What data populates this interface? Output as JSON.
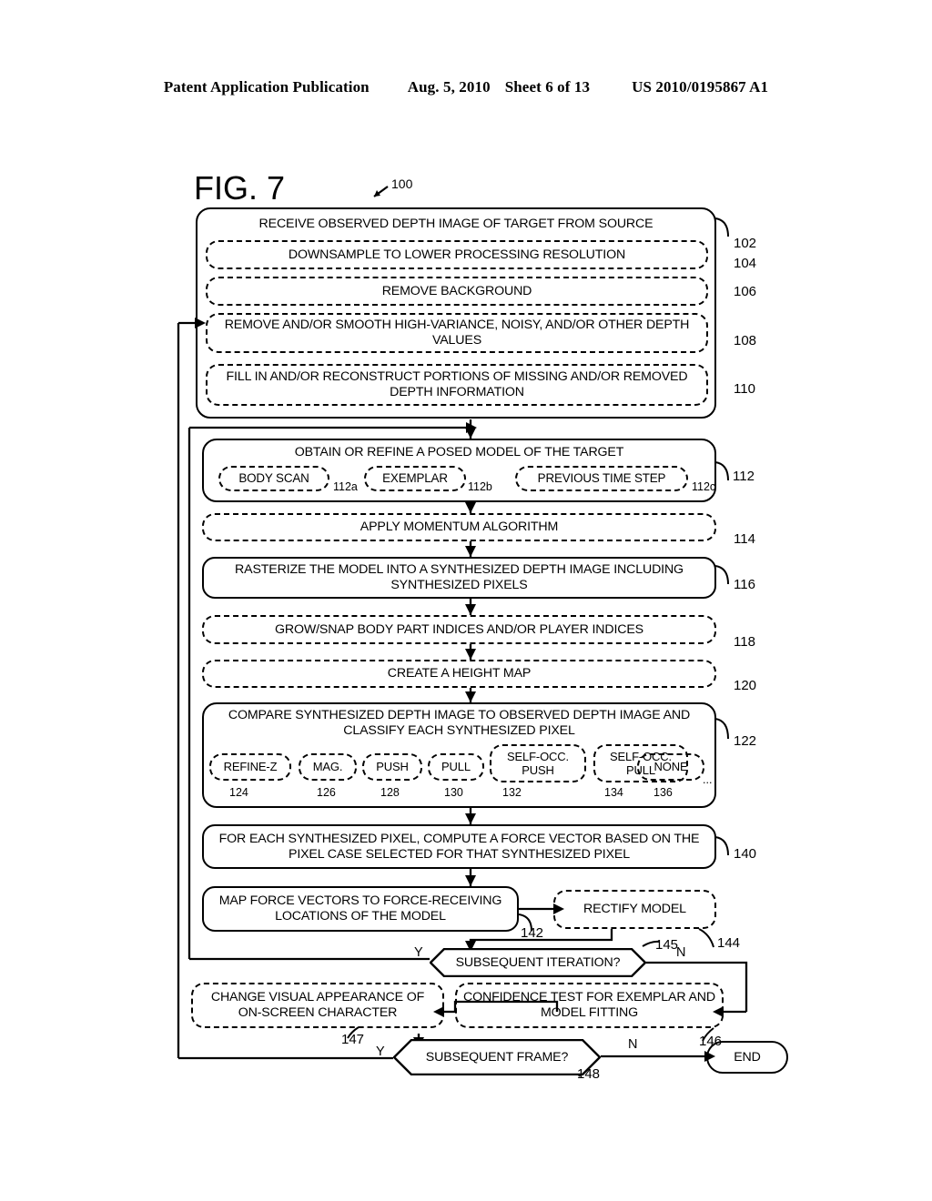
{
  "header": {
    "publication": "Patent Application Publication",
    "date": "Aug. 5, 2010",
    "sheet": "Sheet 6 of 13",
    "number": "US 2010/0195867 A1"
  },
  "figure": {
    "title": "FIG. 7",
    "lead_ref": "100"
  },
  "flow": {
    "group_102": {
      "title": "RECEIVE OBSERVED DEPTH IMAGE OF TARGET FROM SOURCE",
      "ref": "102",
      "steps": [
        {
          "label": "DOWNSAMPLE TO LOWER PROCESSING RESOLUTION",
          "ref": "104"
        },
        {
          "label": "REMOVE BACKGROUND",
          "ref": "106"
        },
        {
          "label": "REMOVE AND/OR SMOOTH HIGH-VARIANCE, NOISY, AND/OR OTHER DEPTH VALUES",
          "ref": "108"
        },
        {
          "label": "FILL IN AND/OR RECONSTRUCT PORTIONS OF MISSING AND/OR REMOVED DEPTH INFORMATION",
          "ref": "110"
        }
      ]
    },
    "group_112": {
      "title": "OBTAIN OR REFINE A POSED MODEL OF THE TARGET",
      "ref": "112",
      "options": [
        {
          "label": "BODY SCAN",
          "ref": "112a"
        },
        {
          "label": "EXEMPLAR",
          "ref": "112b"
        },
        {
          "label": "PREVIOUS TIME STEP",
          "ref": "112c"
        }
      ]
    },
    "step_114": {
      "label": "APPLY MOMENTUM ALGORITHM",
      "ref": "114"
    },
    "step_116": {
      "label": "RASTERIZE THE MODEL INTO A SYNTHESIZED DEPTH IMAGE INCLUDING SYNTHESIZED PIXELS",
      "ref": "116"
    },
    "step_118": {
      "label": "GROW/SNAP BODY PART INDICES AND/OR PLAYER INDICES",
      "ref": "118"
    },
    "step_120": {
      "label": "CREATE A HEIGHT MAP",
      "ref": "120"
    },
    "group_122": {
      "title": "COMPARE SYNTHESIZED DEPTH IMAGE TO OBSERVED DEPTH IMAGE AND CLASSIFY EACH SYNTHESIZED PIXEL",
      "ref": "122",
      "ellipsis": "...",
      "cases": [
        {
          "label": "REFINE-Z",
          "ref": "124"
        },
        {
          "label": "MAG.",
          "ref": "126"
        },
        {
          "label": "PUSH",
          "ref": "128"
        },
        {
          "label": "PULL",
          "ref": "130"
        },
        {
          "label": "SELF-OCC. PUSH",
          "ref": "132"
        },
        {
          "label": "SELF-OCC. PULL",
          "ref": "134"
        },
        {
          "label": "NONE",
          "ref": "136"
        }
      ]
    },
    "step_140": {
      "label": "FOR EACH SYNTHESIZED PIXEL, COMPUTE A FORCE VECTOR BASED ON THE PIXEL CASE SELECTED FOR THAT SYNTHESIZED PIXEL",
      "ref": "140"
    },
    "step_142": {
      "label": "MAP FORCE VECTORS TO FORCE-RECEIVING LOCATIONS OF THE MODEL",
      "ref": "142"
    },
    "step_144": {
      "label": "RECTIFY MODEL",
      "ref": "144"
    },
    "decision_145": {
      "label": "SUBSEQUENT ITERATION?",
      "ref": "145",
      "yes": "Y",
      "no": "N"
    },
    "step_146": {
      "label": "CONFIDENCE TEST FOR EXEMPLAR AND MODEL FITTING",
      "ref": "146"
    },
    "step_147": {
      "label": "CHANGE VISUAL APPEARANCE OF ON-SCREEN CHARACTER",
      "ref": "147"
    },
    "decision_148": {
      "label": "SUBSEQUENT FRAME?",
      "ref": "148",
      "yes": "Y",
      "no": "N"
    },
    "terminal_end": {
      "label": "END"
    }
  }
}
